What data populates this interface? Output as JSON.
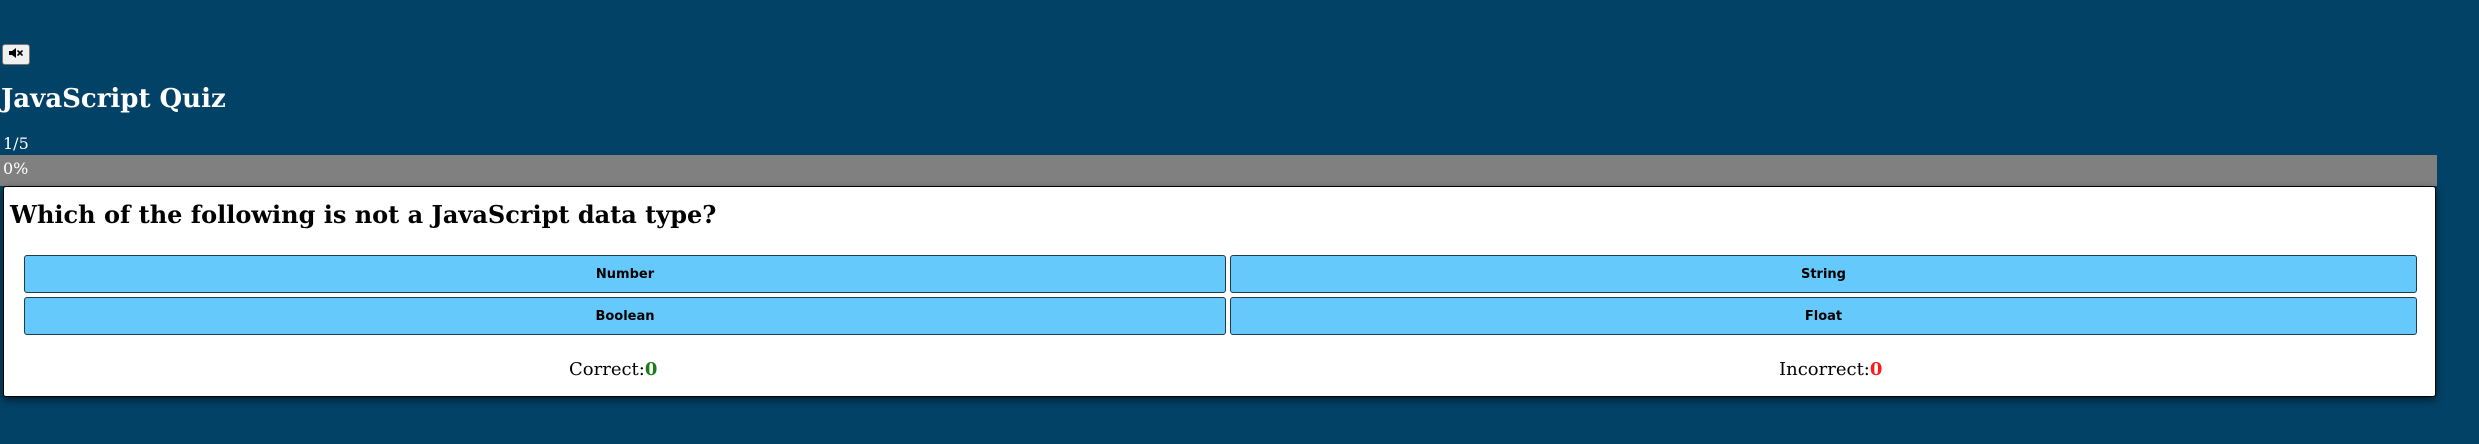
{
  "header": {
    "mute_icon": "speaker-muted-icon",
    "title": "JavaScript Quiz"
  },
  "progress": {
    "counter_text": "1/5",
    "percent_label": "0%",
    "fraction_complete": 0
  },
  "question": {
    "text": "Which of the following is not a JavaScript data type?",
    "answers": [
      "Number",
      "String",
      "Boolean",
      "Float"
    ]
  },
  "score": {
    "correct_label": "Correct:",
    "correct_value": "0",
    "incorrect_label": "Incorrect:",
    "incorrect_value": "0"
  },
  "colors": {
    "background": "#024266",
    "answer_button": "#66c9fc",
    "progress_track": "#808080",
    "correct": "#1b7a1b",
    "incorrect": "#ff1a1a"
  }
}
